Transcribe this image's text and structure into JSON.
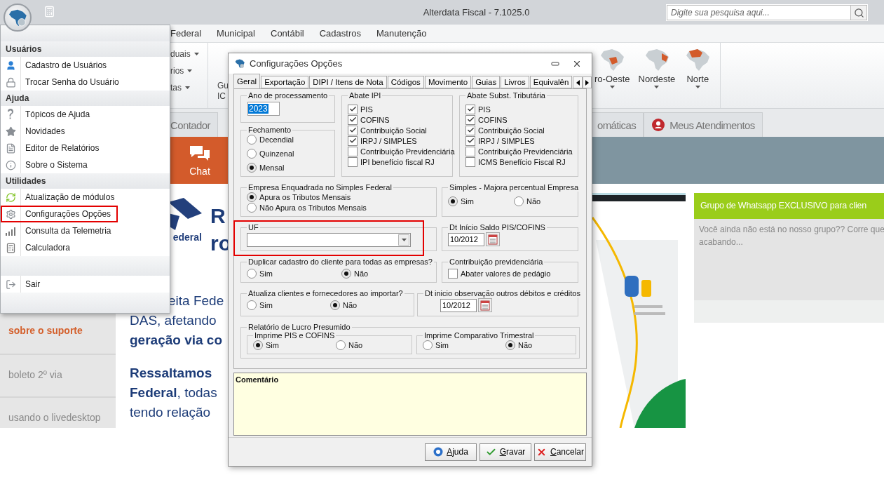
{
  "app": {
    "title": "Alterdata Fiscal - 7.1025.0",
    "search": {
      "placeholder": "Digite sua pesquisa aqui..."
    }
  },
  "ribbon_tabs": [
    {
      "label": "Federal"
    },
    {
      "label": "Municipal"
    },
    {
      "label": "Contábil"
    },
    {
      "label": "Cadastros"
    },
    {
      "label": "Manutenção"
    }
  ],
  "ribbon": {
    "small_items": [
      {
        "label": "duais"
      },
      {
        "label": "rios"
      },
      {
        "label": "tas"
      }
    ],
    "large_button": {
      "lines": [
        "Gu",
        "IC"
      ]
    },
    "regions": [
      {
        "label": "ro-Oeste"
      },
      {
        "label": "Nordeste"
      },
      {
        "label": "Norte"
      }
    ]
  },
  "page_tabs": [
    {
      "label": "Contador"
    },
    {
      "label": "omáticas"
    },
    {
      "label": "Meus Atendimentos"
    }
  ],
  "banner": {
    "chat_label": "Chat"
  },
  "sidebar_links": [
    {
      "label": "sobre o suporte",
      "selected": true
    },
    {
      "label": "boleto 2º via",
      "selected": false
    },
    {
      "label": "usando o livedesktop",
      "selected": false
    }
  ],
  "article": {
    "logo_text": "ederal",
    "heading_lines": [
      "R",
      "ro"
    ],
    "paragraphs": [
      [
        "eita Fede",
        "DAS, afetando",
        "**geração via co**"
      ],
      [
        "**Ressaltamos**",
        "**Federal**, todas",
        "tendo relação"
      ]
    ]
  },
  "whatsapp_card": {
    "title": "Grupo de Whatsapp EXCLUSIVO para clien",
    "body_lines": [
      "Você ainda não está no nosso grupo?? Corre que",
      "acabando..."
    ]
  },
  "menu": {
    "sections": [
      {
        "title": "Usuários",
        "items": [
          {
            "label": "Cadastro de Usuários",
            "highlighted": false
          },
          {
            "label": "Trocar Senha do Usuário",
            "highlighted": false
          }
        ]
      },
      {
        "title": "Ajuda",
        "items": [
          {
            "label": "Tópicos de Ajuda",
            "highlighted": false
          },
          {
            "label": "Novidades",
            "highlighted": false
          },
          {
            "label": "Editor de Relatórios",
            "highlighted": false
          },
          {
            "label": "Sobre o Sistema",
            "highlighted": false
          }
        ]
      },
      {
        "title": "Utilidades",
        "items": [
          {
            "label": "Atualização de módulos",
            "highlighted": false
          },
          {
            "label": "Configurações Opções",
            "highlighted": true
          },
          {
            "label": "Consulta da Telemetria",
            "highlighted": false
          },
          {
            "label": "Calculadora",
            "highlighted": false
          }
        ]
      }
    ],
    "exit_item": {
      "label": "Sair"
    }
  },
  "dialog": {
    "title": "Configurações Opções",
    "tabs": [
      {
        "label": "Geral",
        "selected": true
      },
      {
        "label": "Exportação",
        "selected": false
      },
      {
        "label": "DIPI / Itens de Nota",
        "selected": false
      },
      {
        "label": "Códigos",
        "selected": false
      },
      {
        "label": "Movimento",
        "selected": false
      },
      {
        "label": "Guias",
        "selected": false
      },
      {
        "label": "Livros",
        "selected": false
      },
      {
        "label": "Equivalên",
        "selected": false
      }
    ],
    "ano": {
      "label": "Ano de processamento",
      "value": "2023"
    },
    "fechamento": {
      "label": "Fechamento",
      "options": [
        {
          "label": "Decendial",
          "selected": false
        },
        {
          "label": "Quinzenal",
          "selected": false
        },
        {
          "label": "Mensal",
          "selected": true
        }
      ]
    },
    "abate_ipi": {
      "label": "Abate IPI",
      "options": [
        {
          "label": "PIS",
          "checked": true
        },
        {
          "label": "COFINS",
          "checked": true
        },
        {
          "label": "Contribuição Social",
          "checked": true
        },
        {
          "label": "IRPJ / SIMPLES",
          "checked": true
        },
        {
          "label": "Contribuição Previdenciária",
          "checked": false
        },
        {
          "label": "IPI benefício fiscal RJ",
          "checked": false
        }
      ]
    },
    "abate_st": {
      "label": "Abate Subst. Tributária",
      "options": [
        {
          "label": "PIS",
          "checked": true
        },
        {
          "label": "COFINS",
          "checked": true
        },
        {
          "label": "Contribuição Social",
          "checked": true
        },
        {
          "label": "IRPJ / SIMPLES",
          "checked": true
        },
        {
          "label": "Contribuição Previdenciária",
          "checked": false
        },
        {
          "label": "ICMS Benefício Fiscal RJ",
          "checked": false
        }
      ]
    },
    "simples_federal": {
      "label": "Empresa Enquadrada no Simples Federal",
      "options": [
        {
          "label": "Apura os Tributos Mensais",
          "selected": true
        },
        {
          "label": "Não Apura os Tributos Mensais",
          "selected": false
        }
      ]
    },
    "majora": {
      "label": "Simples - Majora percentual Empresa",
      "options": [
        {
          "label": "Sim",
          "selected": true
        },
        {
          "label": "Não",
          "selected": false
        }
      ]
    },
    "uf": {
      "label": "UF",
      "highlighted": true
    },
    "dt_saldo": {
      "label": "Dt Início Saldo PIS/COFINS",
      "value": "10/2012"
    },
    "duplicar": {
      "label": "Duplicar cadastro do cliente para todas as empresas?",
      "options": [
        {
          "label": "Sim",
          "selected": false
        },
        {
          "label": "Não",
          "selected": true
        }
      ]
    },
    "contrib_prev": {
      "label": "Contribuição previdenciária",
      "option": {
        "label": "Abater valores de pedágio",
        "checked": false
      }
    },
    "atualiza": {
      "label": "Atualiza clientes e fornecedores ao importar?",
      "options": [
        {
          "label": "Sim",
          "selected": false
        },
        {
          "label": "Não",
          "selected": true
        }
      ]
    },
    "dt_obs": {
      "label": "Dt inicio observação outros débitos e créditos",
      "value": "10/2012"
    },
    "lucro": {
      "label": "Relatório de Lucro Presumido",
      "groups": [
        {
          "label": "Imprime PIS e COFINS",
          "options": [
            {
              "label": "Sim",
              "selected": true
            },
            {
              "label": "Não",
              "selected": false
            }
          ]
        },
        {
          "label": "Imprime Comparativo Trimestral",
          "options": [
            {
              "label": "Sim",
              "selected": false
            },
            {
              "label": "Não",
              "selected": true
            }
          ]
        }
      ]
    },
    "comment": {
      "label": "Comentário"
    },
    "buttons": [
      {
        "label": "Ajuda",
        "kind": "help"
      },
      {
        "label": "Gravar",
        "kind": "save"
      },
      {
        "label": "Cancelar",
        "kind": "cancel"
      }
    ]
  }
}
